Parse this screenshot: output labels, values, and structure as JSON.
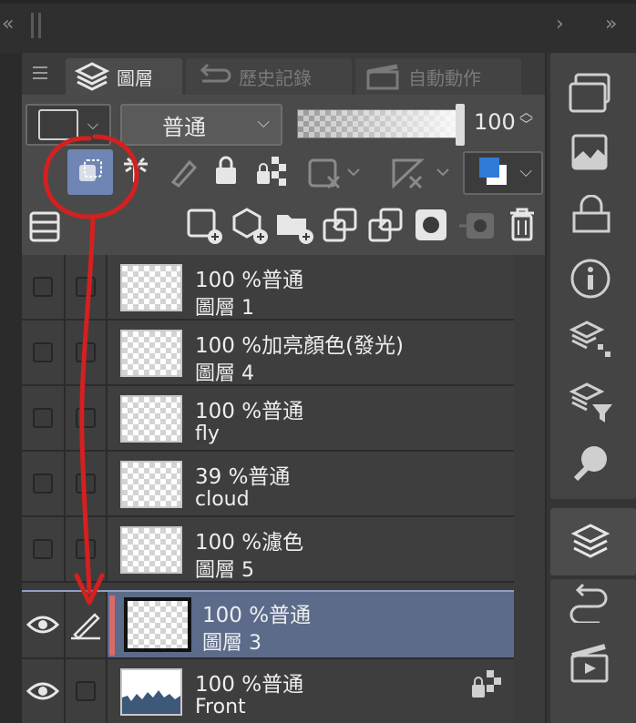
{
  "tabs": [
    {
      "label": "圖層",
      "icon": "layers-icon",
      "active": true
    },
    {
      "label": "歷史記錄",
      "icon": "history-icon",
      "active": false
    },
    {
      "label": "自動動作",
      "icon": "clapperboard-icon",
      "active": false
    }
  ],
  "toolbar": {
    "blend_mode": "普通",
    "opacity_value": "100",
    "accent_color": "#2f7bd8"
  },
  "layers": [
    {
      "opacity_mode": "100 %普通",
      "name": "圖層 1",
      "visible": false,
      "editing": false,
      "selected": false,
      "locked": false
    },
    {
      "opacity_mode": "100 %加亮顏色(發光)",
      "name": "圖層 4",
      "visible": false,
      "editing": false,
      "selected": false,
      "locked": false
    },
    {
      "opacity_mode": "100 %普通",
      "name": "fly",
      "visible": false,
      "editing": false,
      "selected": false,
      "locked": false
    },
    {
      "opacity_mode": "39 %普通",
      "name": "cloud",
      "visible": false,
      "editing": false,
      "selected": false,
      "locked": false
    },
    {
      "opacity_mode": "100 %濾色",
      "name": "圖層 5",
      "visible": false,
      "editing": false,
      "selected": false,
      "locked": false
    },
    {
      "opacity_mode": "100 %普通",
      "name": "圖層 3",
      "visible": true,
      "editing": true,
      "selected": true,
      "locked": false
    },
    {
      "opacity_mode": "100 %普通",
      "name": "Front",
      "visible": true,
      "editing": false,
      "selected": false,
      "locked": true
    }
  ],
  "colors": {
    "selected_row": "#5c6b8a",
    "annotation": "#d42020"
  }
}
